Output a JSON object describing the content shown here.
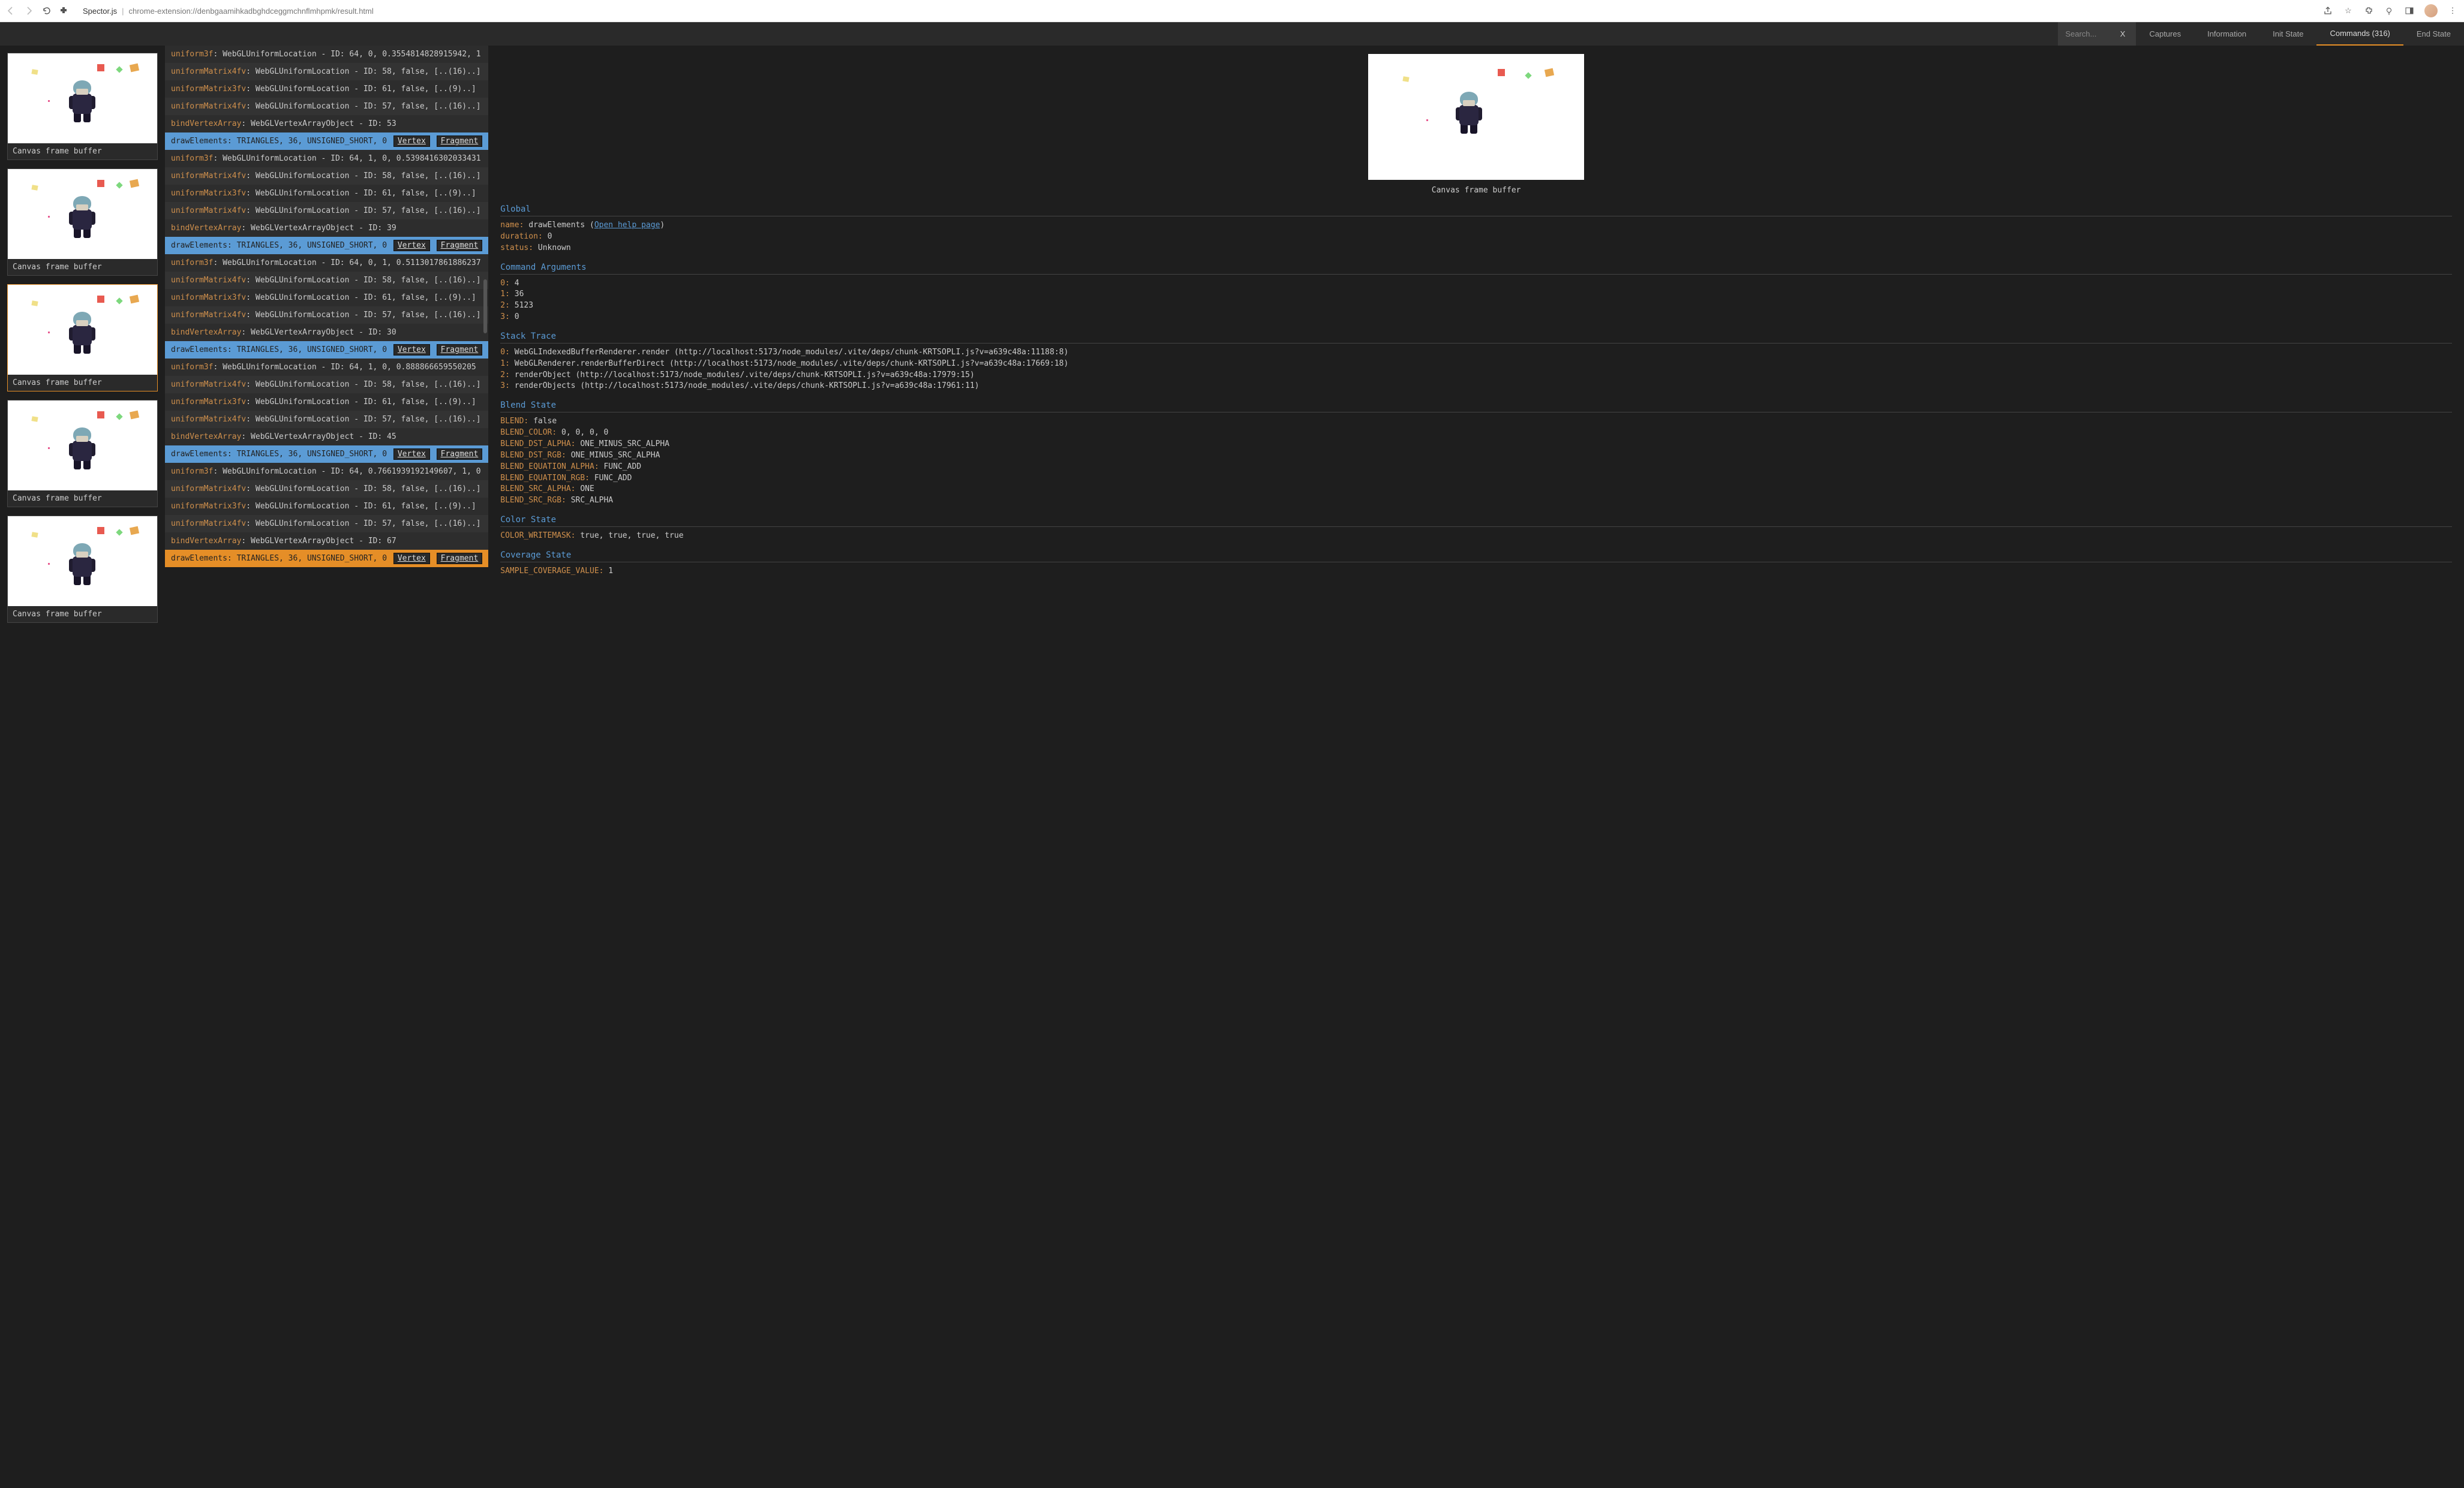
{
  "browser": {
    "title": "Spector.js",
    "url_path": "chrome-extension://denbgaamihkadbghdceggmchnflmhpmk/result.html"
  },
  "toolbar": {
    "search_placeholder": "Search...",
    "clear": "X",
    "tabs": {
      "captures": "Captures",
      "information": "Information",
      "init_state": "Init State",
      "commands": "Commands (316)",
      "end_state": "End State"
    }
  },
  "thumbs": {
    "label": "Canvas frame buffer"
  },
  "commands": [
    {
      "fn": "uniform3f",
      "rest": ": WebGLUniformLocation - ID: 64, 0, 0.3554814828915942, 1",
      "type": "n"
    },
    {
      "fn": "uniformMatrix4fv",
      "rest": ": WebGLUniformLocation - ID: 58, false, [..(16)..]",
      "type": "n"
    },
    {
      "fn": "uniformMatrix3fv",
      "rest": ": WebGLUniformLocation - ID: 61, false, [..(9)..]",
      "type": "n"
    },
    {
      "fn": "uniformMatrix4fv",
      "rest": ": WebGLUniformLocation - ID: 57, false, [..(16)..]",
      "type": "n"
    },
    {
      "fn": "bindVertexArray",
      "rest": ": WebGLVertexArrayObject - ID: 53",
      "type": "n"
    },
    {
      "fn": "drawElements",
      "rest": ": TRIANGLES, 36, UNSIGNED_SHORT, 0",
      "type": "d"
    },
    {
      "fn": "uniform3f",
      "rest": ": WebGLUniformLocation - ID: 64, 1, 0, 0.5398416302033431",
      "type": "n"
    },
    {
      "fn": "uniformMatrix4fv",
      "rest": ": WebGLUniformLocation - ID: 58, false, [..(16)..]",
      "type": "n"
    },
    {
      "fn": "uniformMatrix3fv",
      "rest": ": WebGLUniformLocation - ID: 61, false, [..(9)..]",
      "type": "n"
    },
    {
      "fn": "uniformMatrix4fv",
      "rest": ": WebGLUniformLocation - ID: 57, false, [..(16)..]",
      "type": "n"
    },
    {
      "fn": "bindVertexArray",
      "rest": ": WebGLVertexArrayObject - ID: 39",
      "type": "n"
    },
    {
      "fn": "drawElements",
      "rest": ": TRIANGLES, 36, UNSIGNED_SHORT, 0",
      "type": "d"
    },
    {
      "fn": "uniform3f",
      "rest": ": WebGLUniformLocation - ID: 64, 0, 1, 0.5113017861886237",
      "type": "n"
    },
    {
      "fn": "uniformMatrix4fv",
      "rest": ": WebGLUniformLocation - ID: 58, false, [..(16)..]",
      "type": "n"
    },
    {
      "fn": "uniformMatrix3fv",
      "rest": ": WebGLUniformLocation - ID: 61, false, [..(9)..]",
      "type": "n"
    },
    {
      "fn": "uniformMatrix4fv",
      "rest": ": WebGLUniformLocation - ID: 57, false, [..(16)..]",
      "type": "n"
    },
    {
      "fn": "bindVertexArray",
      "rest": ": WebGLVertexArrayObject - ID: 30",
      "type": "n"
    },
    {
      "fn": "drawElements",
      "rest": ": TRIANGLES, 36, UNSIGNED_SHORT, 0",
      "type": "d"
    },
    {
      "fn": "uniform3f",
      "rest": ": WebGLUniformLocation - ID: 64, 1, 0, 0.888866659550205",
      "type": "n"
    },
    {
      "fn": "uniformMatrix4fv",
      "rest": ": WebGLUniformLocation - ID: 58, false, [..(16)..]",
      "type": "n"
    },
    {
      "fn": "uniformMatrix3fv",
      "rest": ": WebGLUniformLocation - ID: 61, false, [..(9)..]",
      "type": "n"
    },
    {
      "fn": "uniformMatrix4fv",
      "rest": ": WebGLUniformLocation - ID: 57, false, [..(16)..]",
      "type": "n"
    },
    {
      "fn": "bindVertexArray",
      "rest": ": WebGLVertexArrayObject - ID: 45",
      "type": "n"
    },
    {
      "fn": "drawElements",
      "rest": ": TRIANGLES, 36, UNSIGNED_SHORT, 0",
      "type": "d"
    },
    {
      "fn": "uniform3f",
      "rest": ": WebGLUniformLocation - ID: 64, 0.7661939192149607, 1, 0",
      "type": "n"
    },
    {
      "fn": "uniformMatrix4fv",
      "rest": ": WebGLUniformLocation - ID: 58, false, [..(16)..]",
      "type": "n"
    },
    {
      "fn": "uniformMatrix3fv",
      "rest": ": WebGLUniformLocation - ID: 61, false, [..(9)..]",
      "type": "n"
    },
    {
      "fn": "uniformMatrix4fv",
      "rest": ": WebGLUniformLocation - ID: 57, false, [..(16)..]",
      "type": "n"
    },
    {
      "fn": "bindVertexArray",
      "rest": ": WebGLVertexArrayObject - ID: 67",
      "type": "n"
    },
    {
      "fn": "drawElements",
      "rest": ": TRIANGLES, 36, UNSIGNED_SHORT, 0",
      "type": "ds"
    }
  ],
  "shader_links": {
    "vertex": "Vertex",
    "fragment": "Fragment"
  },
  "detail": {
    "preview_label": "Canvas frame buffer",
    "global": {
      "title": "Global",
      "name_k": "name:",
      "name_v": "drawElements (",
      "help": "Open help page",
      "close": ")",
      "dur_k": "duration:",
      "dur_v": "0",
      "status_k": "status:",
      "status_v": "Unknown"
    },
    "args": {
      "title": "Command Arguments",
      "rows": [
        {
          "k": "0:",
          "v": "4"
        },
        {
          "k": "1:",
          "v": "36"
        },
        {
          "k": "2:",
          "v": "5123"
        },
        {
          "k": "3:",
          "v": "0"
        }
      ]
    },
    "stack": {
      "title": "Stack Trace",
      "rows": [
        {
          "k": "0:",
          "v": "WebGLIndexedBufferRenderer.render (http://localhost:5173/node_modules/.vite/deps/chunk-KRTSOPLI.js?v=a639c48a:11188:8)"
        },
        {
          "k": "1:",
          "v": "WebGLRenderer.renderBufferDirect (http://localhost:5173/node_modules/.vite/deps/chunk-KRTSOPLI.js?v=a639c48a:17669:18)"
        },
        {
          "k": "2:",
          "v": "renderObject (http://localhost:5173/node_modules/.vite/deps/chunk-KRTSOPLI.js?v=a639c48a:17979:15)"
        },
        {
          "k": "3:",
          "v": "renderObjects (http://localhost:5173/node_modules/.vite/deps/chunk-KRTSOPLI.js?v=a639c48a:17961:11)"
        }
      ]
    },
    "blend": {
      "title": "Blend State",
      "rows": [
        {
          "k": "BLEND:",
          "v": "false"
        },
        {
          "k": "BLEND_COLOR:",
          "v": "0, 0, 0, 0"
        },
        {
          "k": "BLEND_DST_ALPHA:",
          "v": "ONE_MINUS_SRC_ALPHA"
        },
        {
          "k": "BLEND_DST_RGB:",
          "v": "ONE_MINUS_SRC_ALPHA"
        },
        {
          "k": "BLEND_EQUATION_ALPHA:",
          "v": "FUNC_ADD"
        },
        {
          "k": "BLEND_EQUATION_RGB:",
          "v": "FUNC_ADD"
        },
        {
          "k": "BLEND_SRC_ALPHA:",
          "v": "ONE"
        },
        {
          "k": "BLEND_SRC_RGB:",
          "v": "SRC_ALPHA"
        }
      ]
    },
    "color": {
      "title": "Color State",
      "rows": [
        {
          "k": "COLOR_WRITEMASK:",
          "v": "true, true, true, true"
        }
      ]
    },
    "coverage": {
      "title": "Coverage State",
      "rows": [
        {
          "k": "SAMPLE_COVERAGE_VALUE:",
          "v": "1"
        }
      ]
    }
  }
}
